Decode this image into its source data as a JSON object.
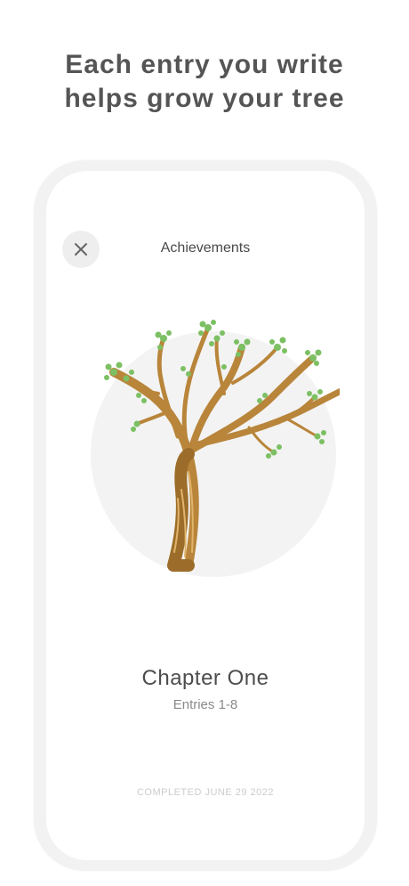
{
  "headline": {
    "line1": "Each entry you write",
    "line2": "helps grow your tree"
  },
  "screen": {
    "title": "Achievements",
    "close_icon": "close-icon",
    "chapter": {
      "title": "Chapter One",
      "entries": "Entries 1-8",
      "completed": "COMPLETED JUNE 29 2022"
    }
  },
  "colors": {
    "trunk": "#b8853a",
    "trunk_dark": "#8a5f22",
    "leaf": "#7cc063",
    "circle": "#f3f3f3"
  }
}
